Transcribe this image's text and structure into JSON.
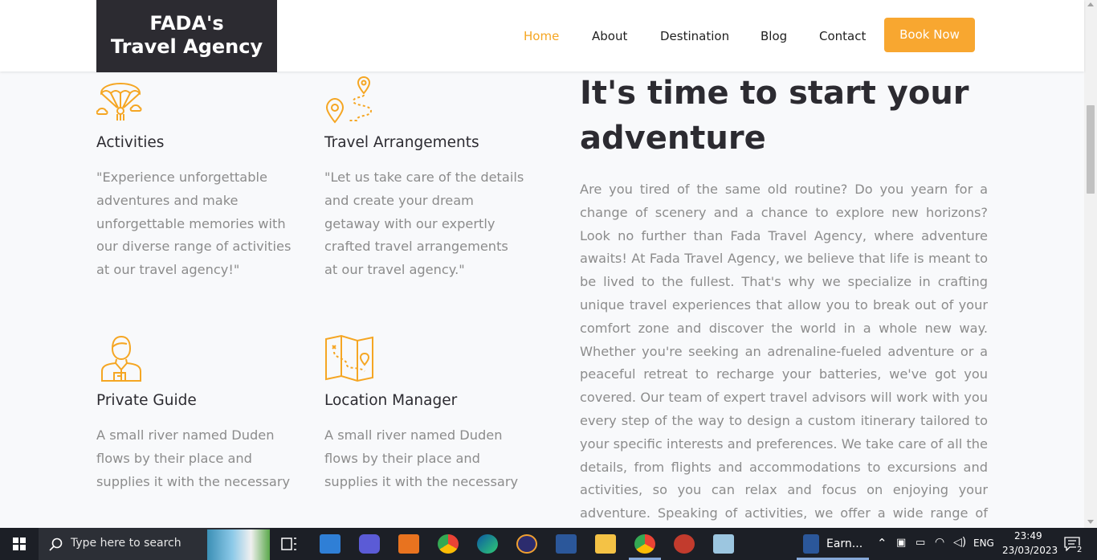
{
  "header": {
    "logo_line1": "FADA's",
    "logo_line2": "Travel Agency",
    "nav": [
      "Home",
      "About",
      "Destination",
      "Blog",
      "Contact"
    ],
    "active": "Home",
    "cta": "Book Now"
  },
  "features": [
    {
      "icon": "parachute-icon",
      "title": "Activities",
      "desc": "\"Experience unforgettable adventures and make unforgettable memories with our diverse range of activities at our travel agency!\""
    },
    {
      "icon": "route-pin-icon",
      "title": "Travel Arrangements",
      "desc": "\"Let us take care of the details and create your dream getaway with our expertly crafted travel arrangements at our travel agency.\""
    },
    {
      "icon": "guide-person-icon",
      "title": "Private Guide",
      "desc": "A small river named Duden flows by their place and supplies it with the necessary"
    },
    {
      "icon": "map-icon",
      "title": "Location Manager",
      "desc": "A small river named Duden flows by their place and supplies it with the necessary"
    }
  ],
  "about": {
    "headline": "It's time to start your adventure",
    "body": "Are you tired of the same old routine? Do you yearn for a change of scenery and a chance to explore new horizons? Look no further than Fada Travel Agency, where adventure awaits! At Fada Travel Agency, we believe that life is meant to be lived to the fullest. That's why we specialize in crafting unique travel experiences that allow you to break out of your comfort zone and discover the world in a whole new way. Whether you're seeking an adrenaline-fueled adventure or a peaceful retreat to recharge your batteries, we've got you covered. Our team of expert travel advisors will work with you every step of the way to design a custom itinerary tailored to your specific interests and preferences. We take care of all the details, from flights and accommodations to excursions and activities, so you can relax and focus on enjoying your adventure. Speaking of activities, we offer a wide range of options to suit every type of"
  },
  "taskbar": {
    "search_placeholder": "Type here to search",
    "active_window": "Earn...",
    "lang": "ENG",
    "time": "23:49",
    "date": "23/03/2023",
    "notifications": "2"
  },
  "colors": {
    "accent": "#f5a623",
    "button": "#f8a730",
    "dark": "#2c2b31",
    "text_gray": "#8c8c8c",
    "bg": "#f8f9fb"
  }
}
